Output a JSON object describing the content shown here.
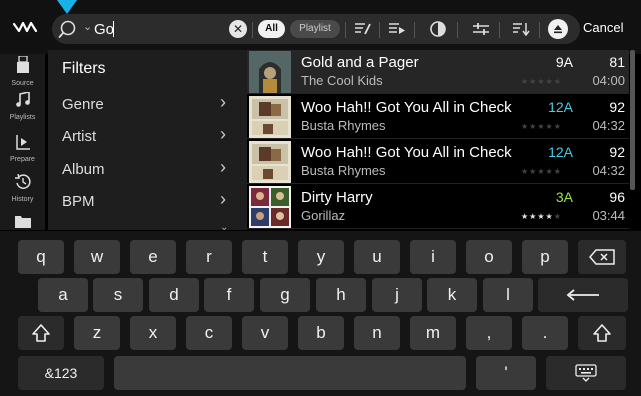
{
  "search": {
    "value": "Go",
    "scope_all": "All",
    "scope_playlist": "Playlist",
    "cancel": "Cancel"
  },
  "toolbar_icons": [
    "edit-list-icon",
    "queue-icon",
    "match-icon",
    "adjust-icon",
    "sort-icon",
    "eject-icon"
  ],
  "sidebar": {
    "items": [
      {
        "label": "Source",
        "icon": "usb-drive-icon"
      },
      {
        "label": "Playlists",
        "icon": "music-note-icon"
      },
      {
        "label": "Prepare",
        "icon": "prepare-icon"
      },
      {
        "label": "History",
        "icon": "history-icon"
      },
      {
        "label": "",
        "icon": "folder-icon"
      }
    ]
  },
  "filters": {
    "title": "Filters",
    "items": [
      "Genre",
      "Artist",
      "Album",
      "BPM"
    ]
  },
  "tracks": [
    {
      "title": "Gold and a Pager",
      "artist": "The Cool Kids",
      "key": "9A",
      "key_color": "#ffffff",
      "bpm": "81",
      "time": "04:00",
      "rating": 0
    },
    {
      "title": "Woo Hah!! Got You All in Check",
      "artist": "Busta Rhymes",
      "key": "12A",
      "key_color": "#3fd0e8",
      "bpm": "92",
      "time": "04:32",
      "rating": 0
    },
    {
      "title": "Woo Hah!! Got You All in Check",
      "artist": "Busta Rhymes",
      "key": "12A",
      "key_color": "#3fd0e8",
      "bpm": "92",
      "time": "04:32",
      "rating": 0
    },
    {
      "title": "Dirty Harry",
      "artist": "Gorillaz",
      "key": "3A",
      "key_color": "#9be64a",
      "bpm": "96",
      "time": "03:44",
      "rating": 4
    }
  ],
  "keyboard": {
    "row1": [
      "q",
      "w",
      "e",
      "r",
      "t",
      "y",
      "u",
      "i",
      "o",
      "p"
    ],
    "row2": [
      "a",
      "s",
      "d",
      "f",
      "g",
      "h",
      "j",
      "k",
      "l"
    ],
    "row3": [
      "z",
      "x",
      "c",
      "v",
      "b",
      "n",
      "m",
      ",",
      "."
    ],
    "symbols": "&123",
    "apostrophe": "'"
  },
  "colors": {
    "accent": "#19b2e6",
    "key_12A": "#3fd0e8",
    "key_3A": "#9be64a"
  }
}
